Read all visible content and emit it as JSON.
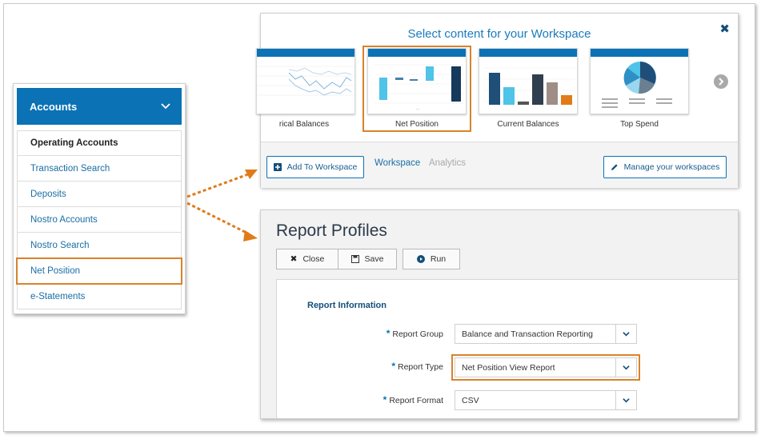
{
  "accounts": {
    "title": "Accounts",
    "items": [
      {
        "label": "Operating Accounts",
        "bold": true
      },
      {
        "label": "Transaction Search"
      },
      {
        "label": "Deposits"
      },
      {
        "label": "Nostro Accounts"
      },
      {
        "label": "Nostro Search"
      },
      {
        "label": "Net Position",
        "highlighted": true
      },
      {
        "label": "e-Statements"
      }
    ]
  },
  "workspace": {
    "title": "Select content for your Workspace",
    "thumbnails": [
      {
        "label": "rical Balances"
      },
      {
        "label": "Net Position",
        "selected": true
      },
      {
        "label": "Current Balances"
      },
      {
        "label": "Top Spend"
      }
    ],
    "add_button": "Add To Workspace",
    "tab_workspace": "Workspace",
    "tab_analytics": "Analytics",
    "manage_button": "Manage your workspaces"
  },
  "report": {
    "title": "Report Profiles",
    "close_button": "Close",
    "save_button": "Save",
    "run_button": "Run",
    "section_title": "Report Information",
    "fields": [
      {
        "label": "Report Group",
        "value": "Balance and Transaction Reporting"
      },
      {
        "label": "Report Type",
        "value": "Net Position View Report",
        "highlighted": true
      },
      {
        "label": "Report Format",
        "value": "CSV"
      }
    ]
  },
  "colors": {
    "primary": "#0b72b5",
    "highlight": "#d9822b",
    "link": "#1a6ea3"
  }
}
